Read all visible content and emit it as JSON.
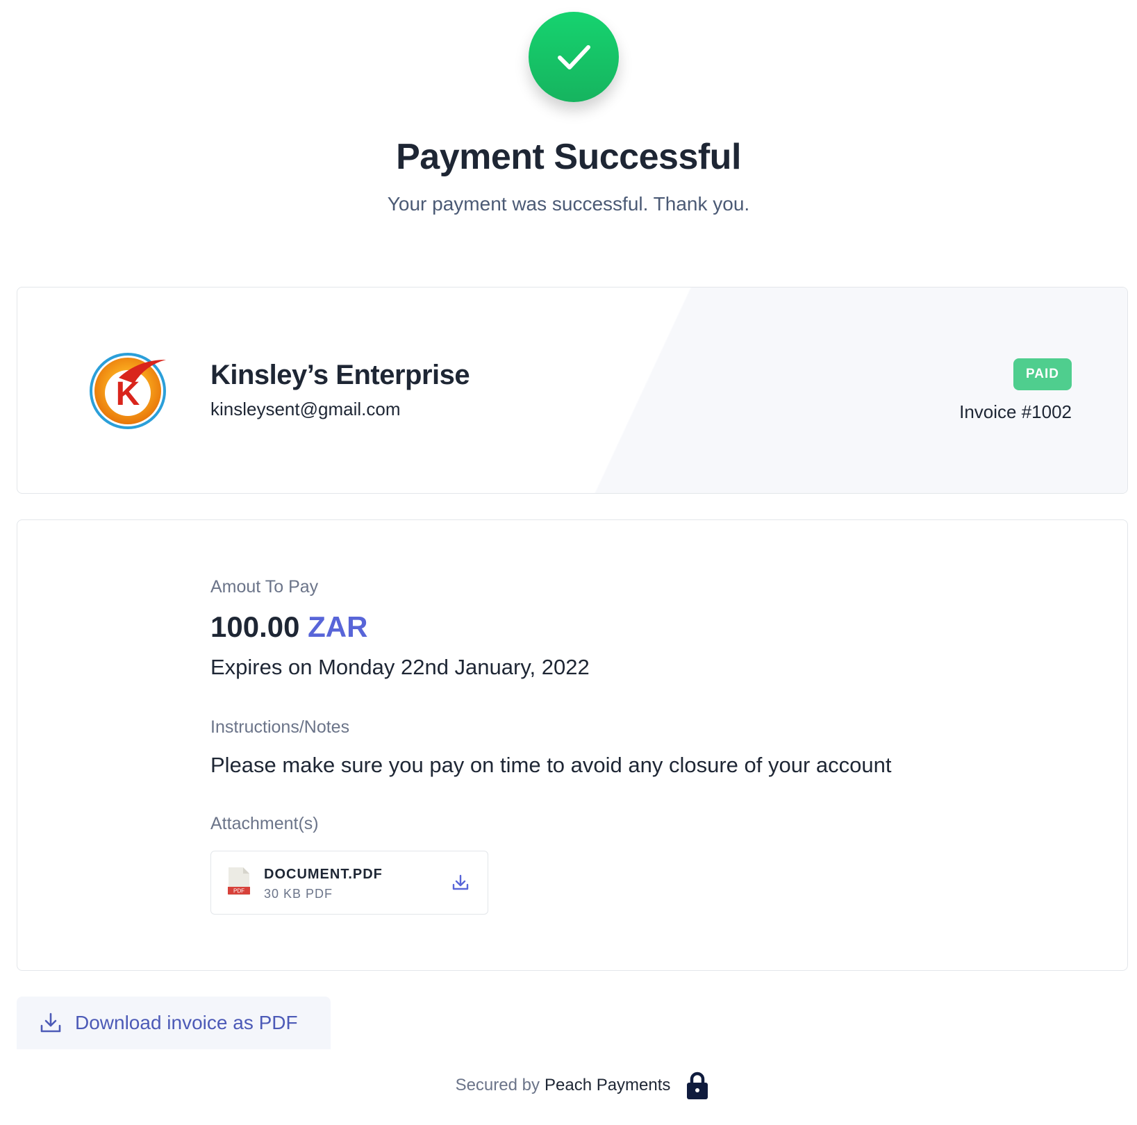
{
  "header": {
    "title": "Payment Successful",
    "subtitle": "Your payment was successful. Thank you.",
    "status_icon": "check-icon",
    "status_color": "#16c466"
  },
  "merchant": {
    "name": "Kinsley’s Enterprise",
    "email": "kinsleysent@gmail.com",
    "logo_letter": "K",
    "status_badge": "PAID",
    "status_color": "#4fce8e",
    "invoice_number": "Invoice #1002"
  },
  "details": {
    "amount_label": "Amout To Pay",
    "amount_value": "100.00",
    "amount_currency": "ZAR",
    "currency_color": "#5865d8",
    "expires": "Expires on Monday 22nd January, 2022",
    "notes_label": "Instructions/Notes",
    "notes": "Please make sure you pay on time to avoid any closure of your account",
    "attachments_label": "Attachment(s)",
    "attachments": [
      {
        "name": "DOCUMENT.PDF",
        "meta": "30 KB PDF",
        "file_tag": "PDF",
        "icon": "pdf-file-icon"
      }
    ]
  },
  "actions": {
    "download_invoice_label": "Download invoice as PDF",
    "download_icon": "download-icon"
  },
  "footer": {
    "secured_by": "Secured by",
    "brand": "Peach Payments",
    "lock_icon": "lock-icon"
  }
}
